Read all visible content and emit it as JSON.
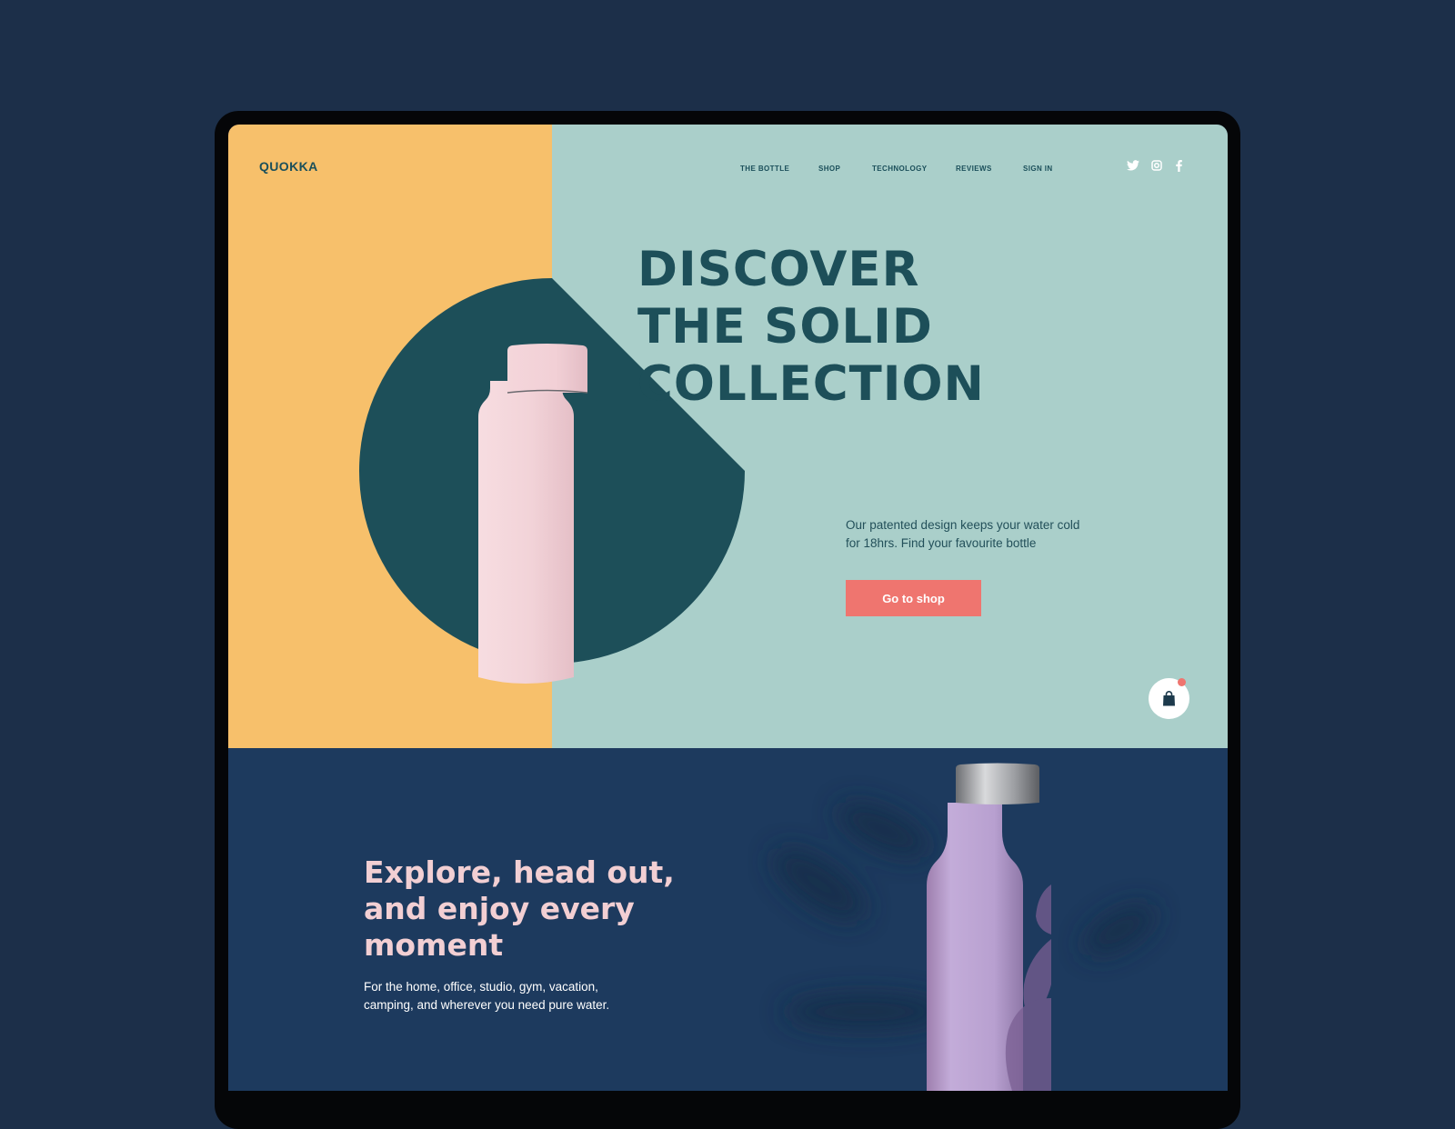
{
  "brand": {
    "logo": "QUOKKA"
  },
  "nav": {
    "items": [
      {
        "label": "THE BOTTLE"
      },
      {
        "label": "SHOP"
      },
      {
        "label": "TECHNOLOGY"
      },
      {
        "label": "REVIEWS"
      },
      {
        "label": "SIGN IN"
      }
    ]
  },
  "social": [
    "twitter-icon",
    "instagram-icon",
    "facebook-icon"
  ],
  "hero": {
    "headline": [
      "DISCOVER",
      "THE SOLID",
      "COLLECTION"
    ],
    "description": "Our patented design keeps your water cold for 18hrs. Find your favourite bottle",
    "cta_label": "Go to shop"
  },
  "cart": {
    "icon": "shopping-bag-icon",
    "has_notification": true
  },
  "section2": {
    "title": [
      "Explore, head out,",
      "and enjoy every",
      "moment"
    ],
    "description": "For the home, office, studio, gym, vacation, camping, and wherever you need pure water."
  },
  "colors": {
    "page_bg": "#1c2f49",
    "hero_left": "#f7c06b",
    "hero_right": "#aacfca",
    "dark_teal": "#1d4f59",
    "cta": "#ef756f",
    "bottle_pink": "#f2d3d8",
    "bottle_lilac": "#b9a3d2",
    "section2_bg": "#1d3a5e",
    "section2_title": "#f2cfd3"
  }
}
